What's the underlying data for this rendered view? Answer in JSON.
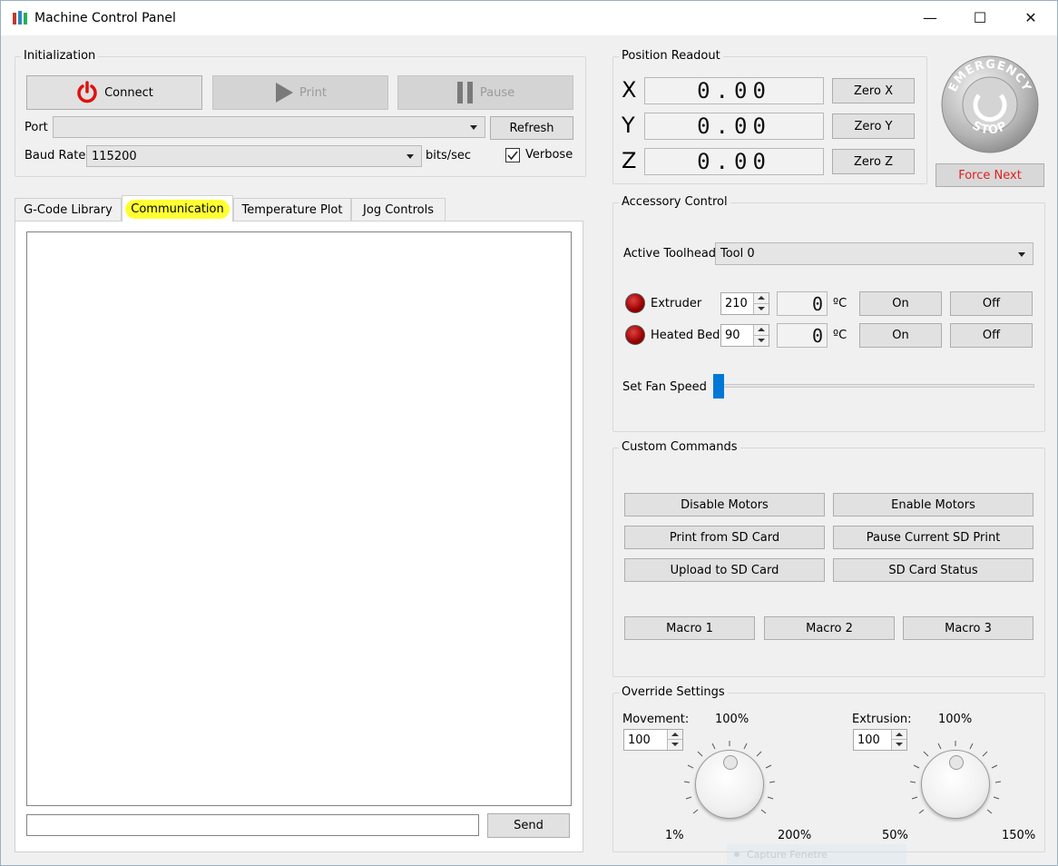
{
  "window": {
    "title": "Machine Control Panel",
    "minimize_glyph": "—",
    "maximize_glyph": "☐",
    "close_glyph": "✕"
  },
  "initialization": {
    "group_label": "Initialization",
    "connect_label": "Connect",
    "print_label": "Print",
    "pause_label": "Pause",
    "port_label": "Port",
    "port_value": "",
    "refresh_label": "Refresh",
    "baud_label": "Baud Rate",
    "baud_value": "115200",
    "baud_unit": "bits/sec",
    "verbose_label": "Verbose",
    "verbose_checked": true
  },
  "tabs": {
    "items": [
      {
        "label": "G-Code Library"
      },
      {
        "label": "Communication"
      },
      {
        "label": "Temperature Plot"
      },
      {
        "label": "Jog Controls"
      }
    ],
    "active": "Communication"
  },
  "communication": {
    "log_text": "",
    "command_value": "",
    "send_label": "Send"
  },
  "position": {
    "group_label": "Position Readout",
    "x_label": "X",
    "x_value": "0.00",
    "zero_x": "Zero X",
    "y_label": "Y",
    "y_value": "0.00",
    "zero_y": "Zero Y",
    "z_label": "Z",
    "z_value": "0.00",
    "zero_z": "Zero Z"
  },
  "emergency": {
    "top_text": "EMERGENCY",
    "bottom_text": "STOP",
    "force_next_label": "Force Next",
    "force_next_color": "#e02020"
  },
  "accessory": {
    "group_label": "Accessory Control",
    "toolhead_label": "Active Toolhead",
    "toolhead_value": "Tool 0",
    "extruder_label": "Extruder",
    "extruder_setpoint": "210",
    "extruder_reading": "0",
    "extruder_unit": "ºC",
    "bed_label": "Heated Bed",
    "bed_setpoint": "90",
    "bed_reading": "0",
    "bed_unit": "ºC",
    "on_label": "On",
    "off_label": "Off",
    "fan_label": "Set Fan Speed",
    "fan_level": 0
  },
  "custom": {
    "group_label": "Custom Commands",
    "disable_motors": "Disable Motors",
    "enable_motors": "Enable Motors",
    "print_sd": "Print from SD Card",
    "pause_sd": "Pause Current SD Print",
    "upload_sd": "Upload to SD Card",
    "sd_status": "SD Card Status",
    "macro1": "Macro 1",
    "macro2": "Macro 2",
    "macro3": "Macro 3"
  },
  "override": {
    "group_label": "Override Settings",
    "movement_label": "Movement:",
    "movement_value": "100",
    "movement_top": "100%",
    "movement_min": "1%",
    "movement_max": "200%",
    "extrusion_label": "Extrusion:",
    "extrusion_value": "100",
    "extrusion_top": "100%",
    "extrusion_min": "50%",
    "extrusion_max": "150%"
  },
  "overlay": {
    "capture_text": "Capture Fenetre"
  }
}
